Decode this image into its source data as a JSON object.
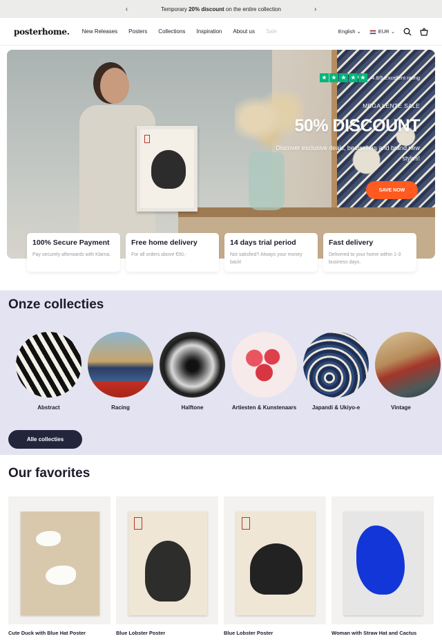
{
  "announcement": {
    "prefix": "Temporary ",
    "highlight": "20% discount",
    "suffix": " on the entire collection"
  },
  "header": {
    "logo": "posterhome.",
    "nav": [
      "New Releases",
      "Posters",
      "Collections",
      "Inspiration",
      "About us",
      "Sale"
    ],
    "language": "English",
    "currency": "EUR"
  },
  "hero": {
    "rating_text": "4.8/5 Excellent rating",
    "kicker": "MEGA LENTE SALE",
    "headline": "50% DISCOUNT",
    "subtext": "Discover exclusive deals, bestsellers and brand new styles!",
    "cta": "SAVE NOW"
  },
  "features": [
    {
      "title": "100% Secure Payment",
      "text": "Pay securely afterwards with Klarna."
    },
    {
      "title": "Free home delivery",
      "text": "For all orders above €50,-"
    },
    {
      "title": "14 days trial period",
      "text": "Not satisfied? Always your money back!"
    },
    {
      "title": "Fast delivery",
      "text": "Delivered to your home within 1-3 business days."
    }
  ],
  "collections": {
    "heading": "Onze collecties",
    "items": [
      "Abstract",
      "Racing",
      "Halftone",
      "Artiesten & Kunstenaars",
      "Japandi & Ukiyo-e",
      "Vintage"
    ],
    "button": "Alle collecties"
  },
  "favorites": {
    "heading": "Our favorites",
    "items": [
      "Cute Duck with Blue Hat Poster",
      "Blue Lobster Poster",
      "Blue Lobster Poster",
      "Woman with Straw Hat and Cactus"
    ]
  },
  "colors": {
    "accent_orange": "#ff5a1f",
    "trustpilot_green": "#00b67a",
    "navy": "#23253d",
    "collection_bg": "#e4e3f1"
  }
}
